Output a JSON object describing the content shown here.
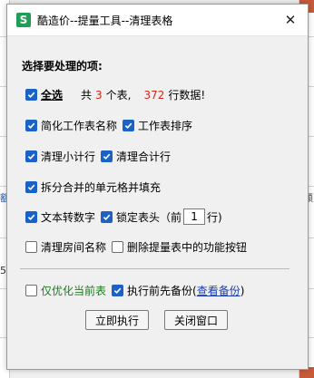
{
  "dialog": {
    "title": "酷造价--提量工具--清理表格",
    "app_icon_letter": "S",
    "close_glyph": "✕",
    "section_title": "选择要处理的项:",
    "summary": {
      "select_all_label": "全选",
      "prefix": "共",
      "table_count": "3",
      "table_unit": "个表,",
      "row_count": "372",
      "row_unit": "行数据!"
    },
    "options": {
      "simplify_names": "简化工作表名称",
      "sort_sheets": "工作表排序",
      "clear_subtotal": "清理小计行",
      "clear_total": "清理合计行",
      "split_merged": "拆分合并的单元格并填充",
      "text_to_number": "文本转数字",
      "lock_header_prefix": "锁定表头（前",
      "lock_header_rows": "1",
      "lock_header_suffix": "行)",
      "clear_room_names": "清理房间名称",
      "delete_buttons": "删除提量表中的功能按钮",
      "only_current": "仅优化当前表",
      "backup_first": "执行前先备份(",
      "view_backup": "查看备份",
      "backup_close_paren": ")"
    },
    "buttons": {
      "execute": "立即执行",
      "close": "关闭窗口"
    }
  },
  "background": {
    "left_fragments": [
      "额",
      "5"
    ],
    "right_fragments": [
      "额"
    ]
  },
  "colors": {
    "checkbox_checked": "#1a62c8",
    "highlight_number": "#d9261c",
    "green_label": "#1e7b1e",
    "link": "#1a3fb5",
    "app_icon": "#1f9e55"
  }
}
